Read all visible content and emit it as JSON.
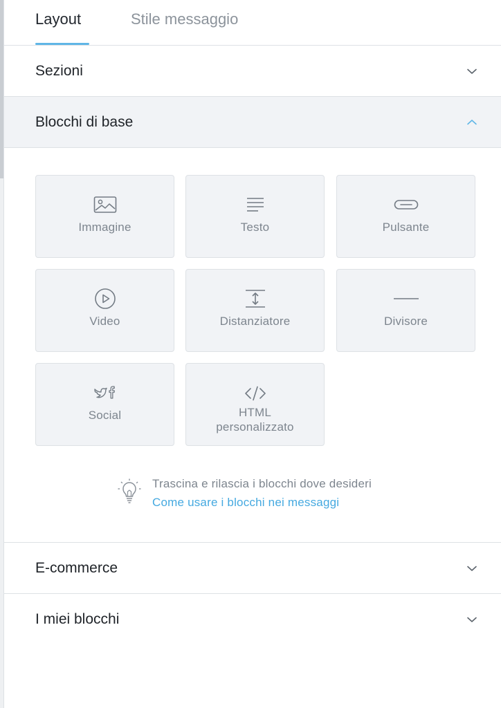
{
  "tabs": {
    "layout": "Layout",
    "style": "Stile messaggio",
    "active": "Layout"
  },
  "sections": {
    "sezioni": "Sezioni",
    "blocchi_base": "Blocchi di base",
    "ecommerce": "E-commerce",
    "miei_blocchi": "I miei blocchi"
  },
  "blocks": {
    "immagine": {
      "label": "Immagine",
      "icon": "image-icon"
    },
    "testo": {
      "label": "Testo",
      "icon": "text-lines-icon"
    },
    "pulsante": {
      "label": "Pulsante",
      "icon": "button-icon"
    },
    "video": {
      "label": "Video",
      "icon": "play-circle-icon"
    },
    "distanziatore": {
      "label": "Distanziatore",
      "icon": "spacer-icon"
    },
    "divisore": {
      "label": "Divisore",
      "icon": "divider-icon"
    },
    "social": {
      "label": "Social",
      "icon": "social-twitter-facebook-icon"
    },
    "html": {
      "label_line1": "HTML",
      "label_line2": "personalizzato",
      "icon": "code-icon"
    }
  },
  "hint": {
    "text": "Trascina e rilascia i blocchi dove desideri",
    "link": "Come usare i blocchi nei messaggi",
    "icon": "lightbulb-icon"
  },
  "colors": {
    "accent": "#5fb6e6",
    "link": "#45a9e0",
    "tile_bg": "#f1f3f6",
    "border": "#dde1e5",
    "muted_text": "#7d858e"
  }
}
